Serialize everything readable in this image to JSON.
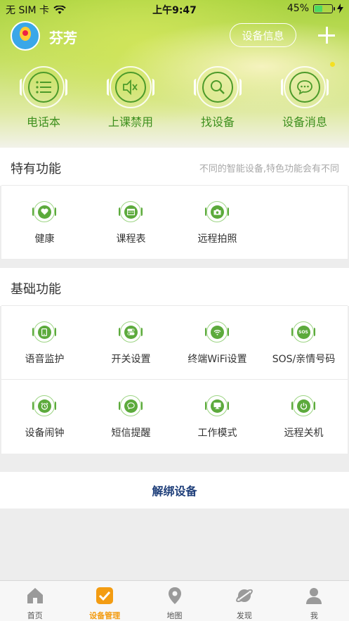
{
  "status_bar": {
    "carrier": "无 SIM 卡",
    "time": "上午9:47",
    "battery": "45%",
    "battery_level": 0.45
  },
  "header": {
    "username": "芬芳",
    "device_info_label": "设备信息"
  },
  "quick_actions": [
    {
      "label": "电话本",
      "icon": "list-icon"
    },
    {
      "label": "上课禁用",
      "icon": "mute-icon"
    },
    {
      "label": "找设备",
      "icon": "search-icon"
    },
    {
      "label": "设备消息",
      "icon": "message-icon"
    }
  ],
  "special": {
    "title": "特有功能",
    "hint": "不同的智能设备,特色功能会有不同",
    "items": [
      {
        "label": "健康",
        "icon": "heart-icon"
      },
      {
        "label": "课程表",
        "icon": "calendar-icon"
      },
      {
        "label": "远程拍照",
        "icon": "camera-icon"
      }
    ]
  },
  "basic": {
    "title": "基础功能",
    "items": [
      {
        "label": "语音监护",
        "icon": "phone-monitor-icon"
      },
      {
        "label": "开关设置",
        "icon": "toggle-icon"
      },
      {
        "label": "终端WiFi设置",
        "icon": "wifi-icon"
      },
      {
        "label": "SOS/亲情号码",
        "icon": "sos-icon",
        "glyph": "SOS"
      },
      {
        "label": "设备闹钟",
        "icon": "alarm-icon"
      },
      {
        "label": "短信提醒",
        "icon": "sms-icon"
      },
      {
        "label": "工作模式",
        "icon": "monitor-icon"
      },
      {
        "label": "远程关机",
        "icon": "power-icon"
      }
    ]
  },
  "unbind_label": "解绑设备",
  "tabs": [
    {
      "label": "首页",
      "icon": "home-icon",
      "active": false
    },
    {
      "label": "设备管理",
      "icon": "check-icon",
      "active": true
    },
    {
      "label": "地图",
      "icon": "map-pin-icon",
      "active": false
    },
    {
      "label": "发现",
      "icon": "planet-icon",
      "active": false
    },
    {
      "label": "我",
      "icon": "person-icon",
      "active": false
    }
  ]
}
